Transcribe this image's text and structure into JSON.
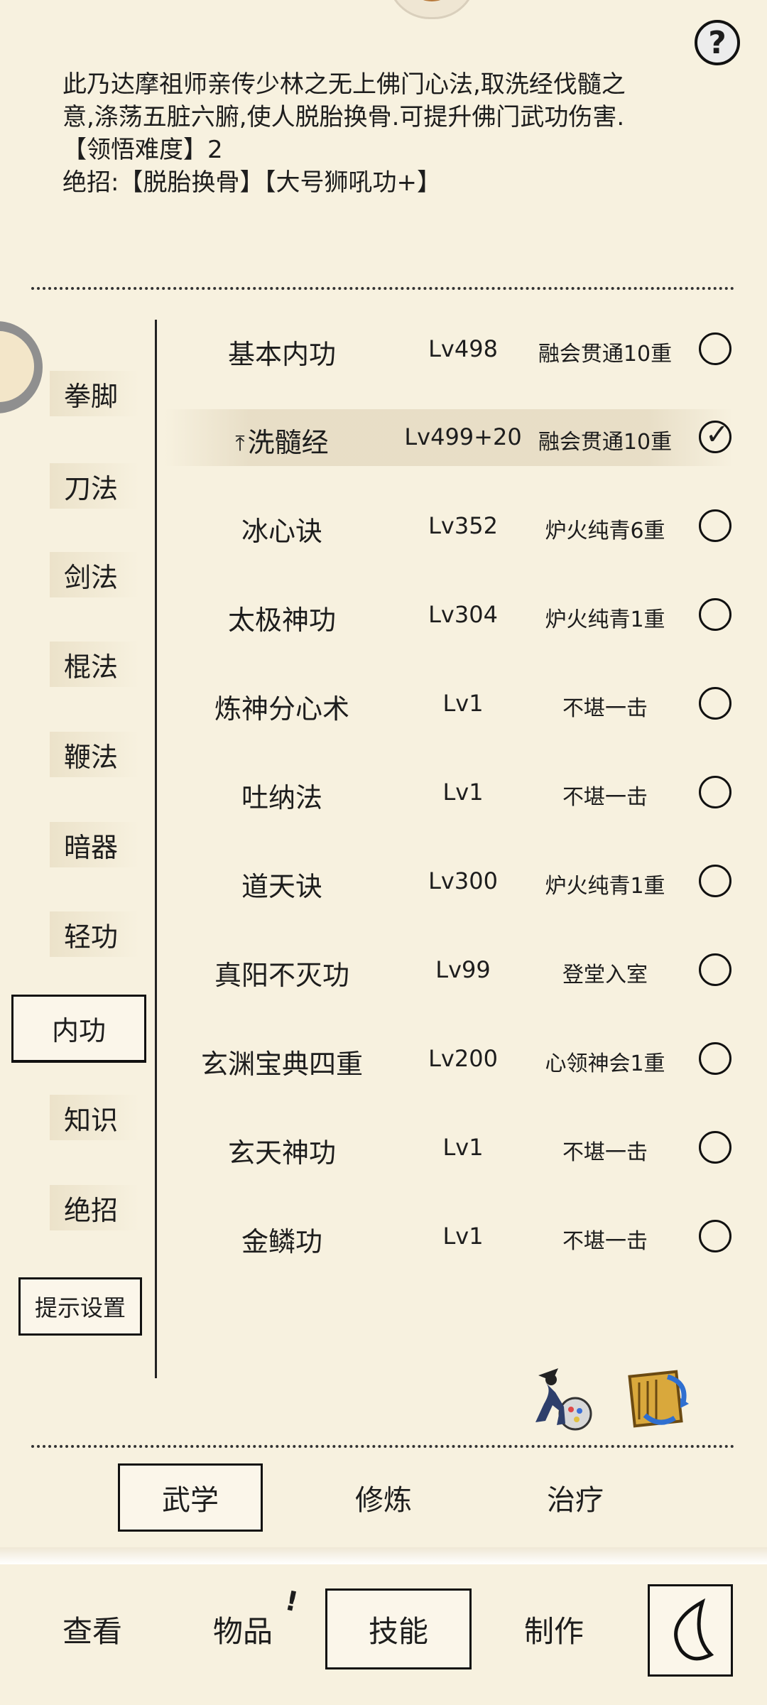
{
  "description": {
    "line1": "此乃达摩祖师亲传少林之无上佛门心法,取洗经伐髓之",
    "line2": "意,涤荡五脏六腑,使人脱胎换骨.可提升佛门武功伤害.",
    "difficulty_label": "【领悟难度】",
    "difficulty_value": "2",
    "ultimate_label": "绝招:",
    "ultimate_moves": "【脱胎换骨】【大号狮吼功+】"
  },
  "help_label": "?",
  "categories": [
    "拳脚",
    "刀法",
    "剑法",
    "棍法",
    "鞭法",
    "暗器",
    "轻功",
    "内功",
    "知识",
    "绝招"
  ],
  "active_category": "内功",
  "hint_settings_label": "提示设置",
  "skills": [
    {
      "name": "基本内功",
      "level": "Lv498",
      "stage": "融会贯通10重",
      "selected": false
    },
    {
      "name": "洗髓经",
      "level": "Lv499+20",
      "stage": "融会贯通10重",
      "selected": true
    },
    {
      "name": "冰心诀",
      "level": "Lv352",
      "stage": "炉火纯青6重",
      "selected": false
    },
    {
      "name": "太极神功",
      "level": "Lv304",
      "stage": "炉火纯青1重",
      "selected": false
    },
    {
      "name": "炼神分心术",
      "level": "Lv1",
      "stage": "不堪一击",
      "selected": false
    },
    {
      "name": "吐纳法",
      "level": "Lv1",
      "stage": "不堪一击",
      "selected": false
    },
    {
      "name": "道天诀",
      "level": "Lv300",
      "stage": "炉火纯青1重",
      "selected": false
    },
    {
      "name": "真阳不灭功",
      "level": "Lv99",
      "stage": "登堂入室",
      "selected": false
    },
    {
      "name": "玄渊宝典四重",
      "level": "Lv200",
      "stage": "心领神会1重",
      "selected": false
    },
    {
      "name": "玄天神功",
      "level": "Lv1",
      "stage": "不堪一击",
      "selected": false
    },
    {
      "name": "金鳞功",
      "level": "Lv1",
      "stage": "不堪一击",
      "selected": false
    }
  ],
  "sub_tabs": [
    "武学",
    "修炼",
    "治疗"
  ],
  "active_sub_tab": "武学",
  "bottom_nav": [
    "查看",
    "物品",
    "技能",
    "制作"
  ],
  "active_nav": "技能",
  "items_badge": "!",
  "icons": [
    "help-icon",
    "up-arrow-icon",
    "check-icon",
    "ninja-paint-icon",
    "book-swap-icon",
    "back-icon"
  ]
}
